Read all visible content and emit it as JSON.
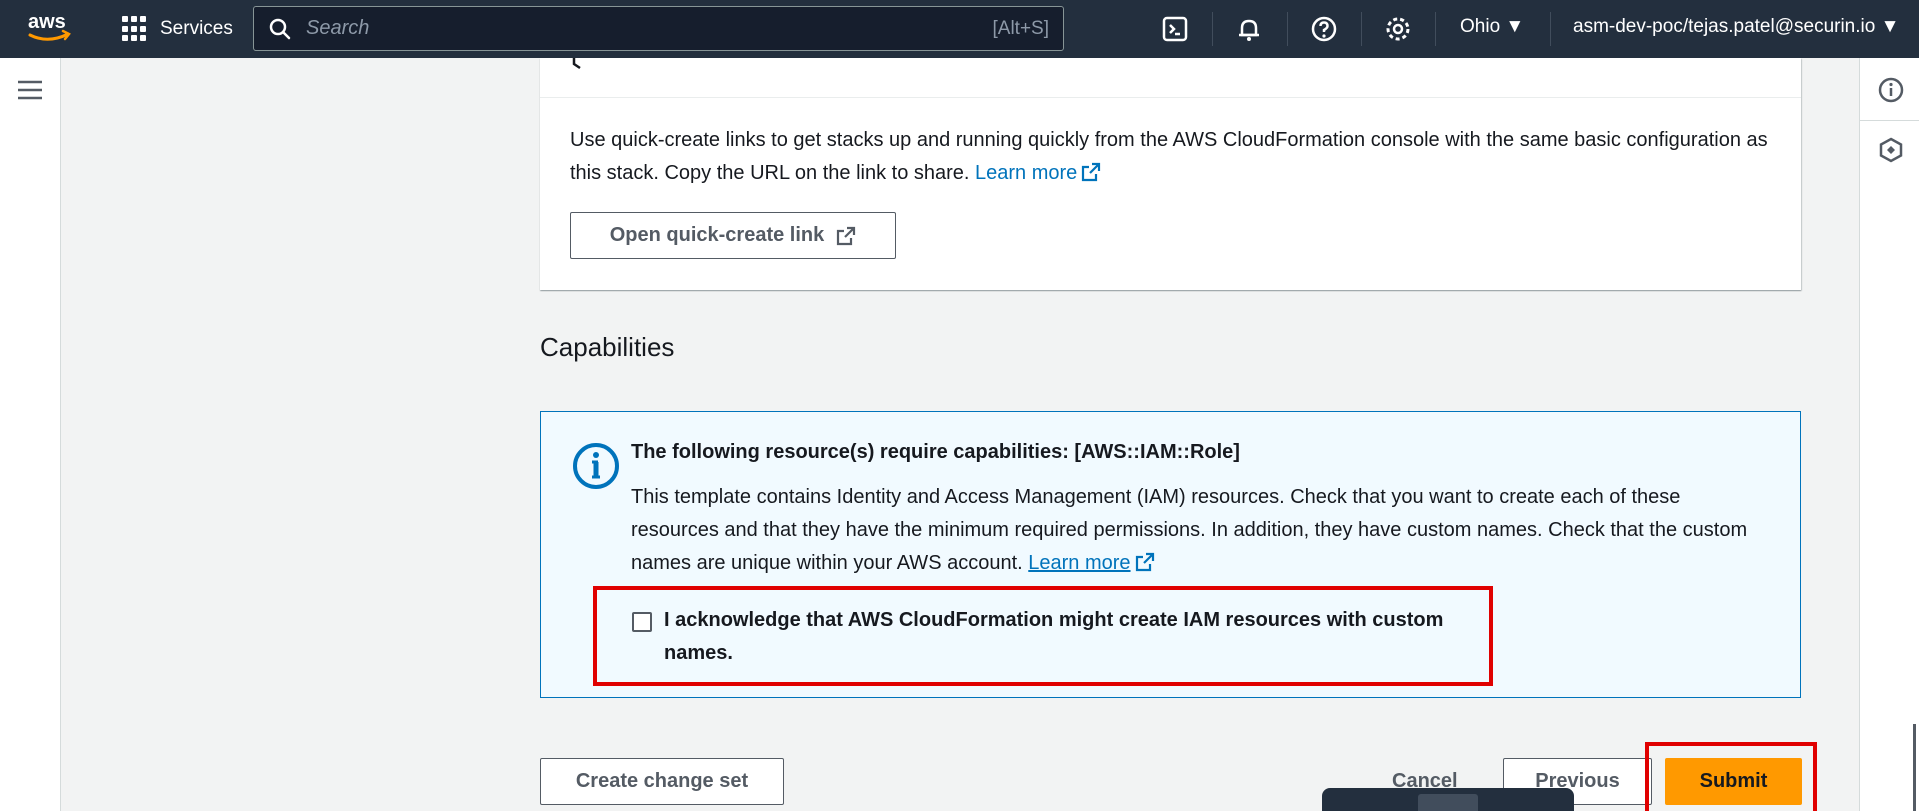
{
  "topnav": {
    "logo_text": "aws",
    "services_label": "Services",
    "search_placeholder": "Search",
    "search_shortcut": "[Alt+S]",
    "region": "Ohio",
    "account": "asm-dev-poc/tejas.patel@securin.io"
  },
  "quick_create": {
    "description": "Use quick-create links to get stacks up and running quickly from the AWS CloudFormation console with the same basic configuration as this stack. Copy the URL on the link to share.",
    "learn_more": "Learn more",
    "open_button": "Open quick-create link"
  },
  "capabilities": {
    "title": "Capabilities",
    "alert_title": "The following resource(s) require capabilities: [AWS::IAM::Role]",
    "alert_body": "This template contains Identity and Access Management (IAM) resources. Check that you want to create each of these resources and that they have the minimum required permissions. In addition, they have custom names. Check that the custom names are unique within your AWS account.",
    "learn_more": "Learn more",
    "ack_label": "I acknowledge that AWS CloudFormation might create IAM resources with custom names.",
    "ack_checked": false
  },
  "footer": {
    "create_change_set": "Create change set",
    "cancel": "Cancel",
    "previous": "Previous",
    "submit": "Submit"
  },
  "colors": {
    "nav_bg": "#232f3e",
    "link": "#0073bb",
    "primary": "#ff9900",
    "highlight": "#e00000"
  }
}
